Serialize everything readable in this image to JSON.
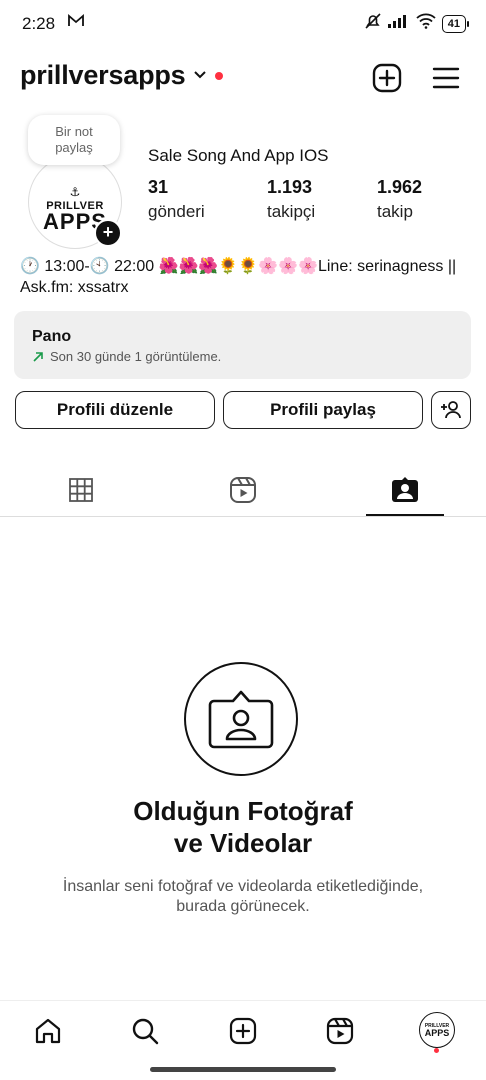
{
  "status_bar": {
    "time": "2:28",
    "battery": "41"
  },
  "header": {
    "username": "prillversapps"
  },
  "profile": {
    "note_line1": "Bir not",
    "note_line2": "paylaş",
    "avatar_brand_small": "PRILLVER",
    "avatar_brand_big": "APPS",
    "full_name": "Sale Song And App IOS",
    "stats": [
      {
        "value": "31",
        "label": "gönderi"
      },
      {
        "value": "1.193",
        "label": "takipçi"
      },
      {
        "value": "1.962",
        "label": "takip"
      }
    ],
    "bio": "🕐 13:00-🕙 22:00 🌺🌺🌺🌻🌻🌸🌸🌸Line: serinagness || Ask.fm: xssatrx"
  },
  "pano": {
    "title": "Pano",
    "subtitle": "Son 30 günde 1 görüntüleme."
  },
  "buttons": {
    "edit": "Profili düzenle",
    "share": "Profili paylaş"
  },
  "empty_state": {
    "title_line1": "Olduğun Fotoğraf",
    "title_line2": "ve Videolar",
    "subtitle": "İnsanlar seni fotoğraf ve videolarda etiketlediğinde, burada görünecek."
  },
  "nav_avatar": {
    "small": "PRILLVER",
    "big": "APPS"
  },
  "colors": {
    "accent_red": "#ff3040",
    "pano_bg": "#efefef",
    "trend_green": "#1a9a4a"
  }
}
